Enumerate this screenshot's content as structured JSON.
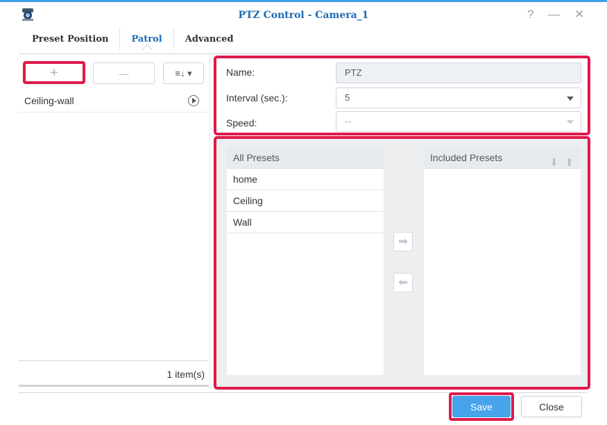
{
  "window": {
    "title": "PTZ Control - Camera_1",
    "help_glyph": "?",
    "minimize_glyph": "—",
    "close_glyph": "✕"
  },
  "tabs": [
    {
      "label": "Preset Position",
      "active": false
    },
    {
      "label": "Patrol",
      "active": true
    },
    {
      "label": "Advanced",
      "active": false
    }
  ],
  "toolbar": {
    "add_glyph": "+",
    "remove_glyph": "—",
    "sort_glyph": "≡↓ ▾",
    "add_icon": "plus-icon",
    "remove_icon": "minus-icon",
    "sort_icon": "sort-icon"
  },
  "patrol_list": {
    "items": [
      {
        "name": "Ceiling-wall",
        "action_icon": "play-icon"
      }
    ],
    "footer_count": "1 item(s)"
  },
  "form": {
    "name_label": "Name:",
    "name_value": "PTZ",
    "interval_label": "Interval (sec.):",
    "interval_value": "5",
    "speed_label": "Speed:",
    "speed_value": "--"
  },
  "all_presets": {
    "header": "All Presets",
    "items": [
      "home",
      "Ceiling",
      "Wall"
    ]
  },
  "included_presets": {
    "header": "Included Presets",
    "down_glyph": "⬇",
    "up_glyph": "⬆",
    "items": []
  },
  "transfer": {
    "add_glyph": "➡",
    "remove_glyph": "⬅"
  },
  "buttons": {
    "save": "Save",
    "close": "Close"
  },
  "colors": {
    "accent": "#1f6bb3",
    "primary_button": "#47a3ea",
    "highlight_border": "#e0194a"
  }
}
